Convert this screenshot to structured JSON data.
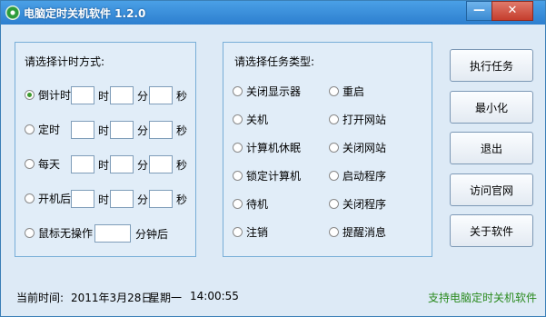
{
  "window": {
    "title": "电脑定时关机软件 1.2.0",
    "min_label": "—",
    "close_label": "✕",
    "accent": "#2d7fcf"
  },
  "timing_panel": {
    "title": "请选择计时方式:",
    "modes": [
      {
        "label": "倒计时",
        "checked": true,
        "units": [
          "时",
          "分",
          "秒"
        ]
      },
      {
        "label": "定时",
        "checked": false,
        "units": [
          "时",
          "分",
          "秒"
        ]
      },
      {
        "label": "每天",
        "checked": false,
        "units": [
          "时",
          "分",
          "秒"
        ]
      },
      {
        "label": "开机后",
        "checked": false,
        "units": [
          "时",
          "分",
          "秒"
        ]
      }
    ],
    "idle": {
      "label": "鼠标无操作",
      "unit": "分钟后"
    }
  },
  "task_panel": {
    "title": "请选择任务类型:",
    "left": [
      "关闭显示器",
      "关机",
      "计算机休眠",
      "锁定计算机",
      "待机",
      "注销"
    ],
    "right": [
      "重启",
      "打开网站",
      "关闭网站",
      "启动程序",
      "关闭程序",
      "提醒消息"
    ]
  },
  "buttons": [
    "执行任务",
    "最小化",
    "退出",
    "访问官网",
    "关于软件"
  ],
  "status": {
    "label": "当前时间:",
    "date": "2011年3月28日",
    "weekday": "星期一",
    "time": "14:00:55",
    "support_link": "支持电脑定时关机软件"
  }
}
